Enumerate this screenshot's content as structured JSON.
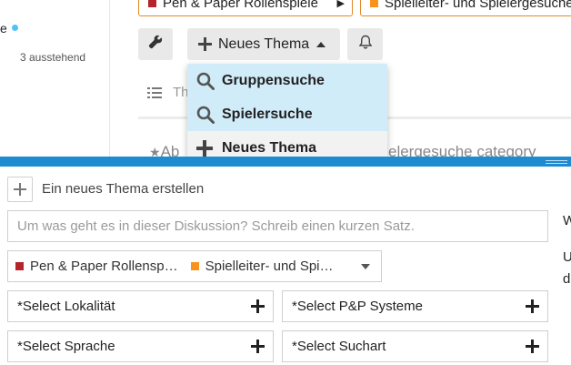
{
  "sidebar": {
    "partial_label": "e",
    "pending": "3 ausstehend"
  },
  "breadcrumbs": [
    {
      "label": "Pen & Paper Rollenspiele",
      "color": "#b5242a"
    },
    {
      "label": "Spielleiter- und Spielergesuche",
      "color": "#f7941d"
    }
  ],
  "toolbar": {
    "wrench_icon": "wrench-icon",
    "new_topic_label": "Neues Thema",
    "bell_icon": "bell-icon"
  },
  "dropdown": {
    "items": [
      {
        "label": "Gruppensuche",
        "icon": "search-icon",
        "highlighted": true
      },
      {
        "label": "Spielersuche",
        "icon": "search-icon",
        "highlighted": true
      },
      {
        "label": "Neues Thema",
        "icon": "plus-icon",
        "highlighted": false
      }
    ]
  },
  "background": {
    "partial_tab": "Th",
    "category_prefix": "Ab",
    "category_suffix": "elergesuche category"
  },
  "composer": {
    "title": "Ein neues Thema erstellen",
    "title_placeholder": "Um was geht es in dieser Diskussion? Schreib einen kurzen Satz.",
    "categories": [
      {
        "label": "Pen & Paper Rollensp…",
        "color": "#b5242a"
      },
      {
        "label": "Spielleiter- und Spi…",
        "color": "#f7941d"
      }
    ],
    "tag_selectors": [
      "*Select Lokalität",
      "*Select P&P Systeme",
      "*Select Sprache",
      "*Select Suchart"
    ],
    "right_partial": [
      "W",
      "U",
      "d"
    ]
  }
}
